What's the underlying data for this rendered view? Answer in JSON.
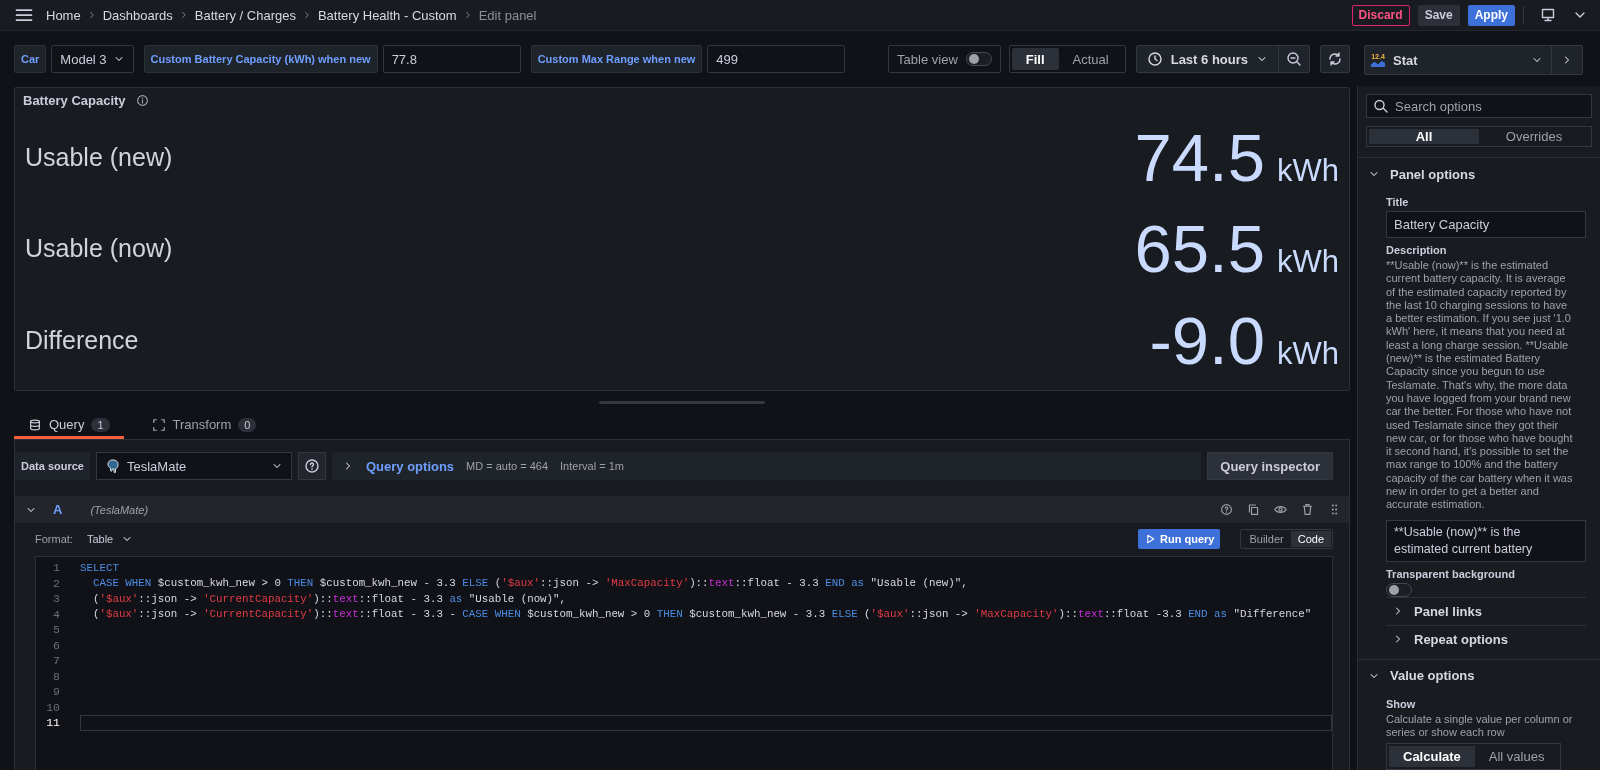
{
  "topbar": {
    "breadcrumbs": [
      {
        "label": "Home",
        "current": false
      },
      {
        "label": "Dashboards",
        "current": false
      },
      {
        "label": "Battery / Charges",
        "current": false
      },
      {
        "label": "Battery Health - Custom",
        "current": false
      },
      {
        "label": "Edit panel",
        "current": true
      }
    ],
    "buttons": [
      {
        "label": "Discard",
        "kind": "destructive"
      },
      {
        "label": "Save",
        "kind": "secondary"
      },
      {
        "label": "Apply",
        "kind": "primary"
      }
    ]
  },
  "variables": [
    {
      "label": "Car",
      "kind": "select",
      "value": "Model 3"
    },
    {
      "label": "Custom Battery Capacity (kWh) when new",
      "kind": "text",
      "value": "77.8"
    },
    {
      "label": "Custom Max Range when new",
      "kind": "text",
      "value": "499"
    }
  ],
  "toolbar": {
    "table_view": {
      "label": "Table view",
      "on": false
    },
    "fill_modes": [
      {
        "label": "Fill",
        "selected": true
      },
      {
        "label": "Actual",
        "selected": false
      }
    ],
    "time_range": "Last 6 hours"
  },
  "visualization": {
    "badge": "12.4",
    "name": "Stat"
  },
  "panel": {
    "title": "Battery Capacity",
    "stats": [
      {
        "label": "Usable (new)",
        "value": "74.5",
        "unit": "kWh"
      },
      {
        "label": "Usable (now)",
        "value": "65.5",
        "unit": "kWh"
      },
      {
        "label": "Difference",
        "value": "-9.0",
        "unit": "kWh"
      }
    ]
  },
  "query_tabs": [
    {
      "label": "Query",
      "count": "1",
      "selected": true
    },
    {
      "label": "Transform",
      "count": "0",
      "selected": false
    }
  ],
  "data_source": {
    "label": "Data source",
    "value": "TeslaMate",
    "query_options": "Query options",
    "md": "MD = auto = 464",
    "interval": "Interval = 1m",
    "inspector": "Query inspector"
  },
  "query": {
    "ref": "A",
    "source": "(TeslaMate)",
    "format_label": "Format:",
    "format": "Table",
    "run": "Run query",
    "modes": [
      {
        "label": "Builder",
        "selected": false
      },
      {
        "label": "Code",
        "selected": true
      }
    ],
    "lines": [
      {
        "number": "1",
        "active": false,
        "tokens": [
          {
            "kind": "keyword",
            "text": "SELECT"
          }
        ]
      },
      {
        "number": "2",
        "active": false,
        "tokens": [
          {
            "kind": "keyword",
            "text": "  CASE WHEN"
          },
          {
            "kind": "plain",
            "text": " $custom_kwh_new > 0 "
          },
          {
            "kind": "keyword",
            "text": "THEN"
          },
          {
            "kind": "plain",
            "text": " $custom_kwh_new - 3.3 "
          },
          {
            "kind": "keyword",
            "text": "ELSE"
          },
          {
            "kind": "plain",
            "text": " ("
          },
          {
            "kind": "string",
            "text": "'$aux'"
          },
          {
            "kind": "plain",
            "text": "::json -> "
          },
          {
            "kind": "string",
            "text": "'MaxCapacity'"
          },
          {
            "kind": "plain",
            "text": ")::"
          },
          {
            "kind": "type",
            "text": "text"
          },
          {
            "kind": "plain",
            "text": "::float - 3.3 "
          },
          {
            "kind": "keyword",
            "text": "END as"
          },
          {
            "kind": "plain",
            "text": " \"Usable (new)\","
          }
        ]
      },
      {
        "number": "3",
        "active": false,
        "tokens": [
          {
            "kind": "plain",
            "text": "  ("
          },
          {
            "kind": "string",
            "text": "'$aux'"
          },
          {
            "kind": "plain",
            "text": "::json -> "
          },
          {
            "kind": "string",
            "text": "'CurrentCapacity'"
          },
          {
            "kind": "plain",
            "text": ")::"
          },
          {
            "kind": "type",
            "text": "text"
          },
          {
            "kind": "plain",
            "text": "::float - 3.3 "
          },
          {
            "kind": "keyword",
            "text": "as"
          },
          {
            "kind": "plain",
            "text": " \"Usable (now)\","
          }
        ]
      },
      {
        "number": "4",
        "active": false,
        "tokens": [
          {
            "kind": "plain",
            "text": "  ("
          },
          {
            "kind": "string",
            "text": "'$aux'"
          },
          {
            "kind": "plain",
            "text": "::json -> "
          },
          {
            "kind": "string",
            "text": "'CurrentCapacity'"
          },
          {
            "kind": "plain",
            "text": ")::"
          },
          {
            "kind": "type",
            "text": "text"
          },
          {
            "kind": "plain",
            "text": "::float - 3.3 - "
          },
          {
            "kind": "keyword",
            "text": "CASE WHEN"
          },
          {
            "kind": "plain",
            "text": " $custom_kwh_new > 0 "
          },
          {
            "kind": "keyword",
            "text": "THEN"
          },
          {
            "kind": "plain",
            "text": " $custom_kwh_new - 3.3 "
          },
          {
            "kind": "keyword",
            "text": "ELSE"
          },
          {
            "kind": "plain",
            "text": " ("
          },
          {
            "kind": "string",
            "text": "'$aux'"
          },
          {
            "kind": "plain",
            "text": "::json -> "
          },
          {
            "kind": "string",
            "text": "'MaxCapacity'"
          },
          {
            "kind": "plain",
            "text": ")::"
          },
          {
            "kind": "type",
            "text": "text"
          },
          {
            "kind": "plain",
            "text": "::float -3.3 "
          },
          {
            "kind": "keyword",
            "text": "END as"
          },
          {
            "kind": "plain",
            "text": " \"Difference\""
          }
        ]
      },
      {
        "number": "5",
        "active": false
      },
      {
        "number": "6",
        "active": false
      },
      {
        "number": "7",
        "active": false
      },
      {
        "number": "8",
        "active": false
      },
      {
        "number": "9",
        "active": false
      },
      {
        "number": "10",
        "active": false
      },
      {
        "number": "11",
        "active": true
      }
    ]
  },
  "options": {
    "search_placeholder": "Search options",
    "tabs": [
      {
        "label": "All",
        "selected": true
      },
      {
        "label": "Overrides",
        "selected": false
      }
    ],
    "panel_options": {
      "title": "Panel options",
      "expanded": true,
      "title_label": "Title",
      "title_value": "Battery Capacity",
      "description_label": "Description",
      "description": "**Usable (now)** is the estimated current battery capacity. It is average of the estimated capacity reported by the last 10 charging sessions to have a better estimation. If you see just '1.0 kWh' here, it means that you need at least a long charge session. **Usable (new)** is the estimated Battery Capacity since you begun to use Teslamate. That's why, the more data you have logged from your brand new car the better. For those who have not used Teslamate since they got their new car, or for those who have bought it second hand, it's possible to set the max range to 100% and the battery capacity of the car battery when it was new in order to get a better and accurate estimation.",
      "description_value": "**Usable (now)** is the estimated current battery",
      "transparent_label": "Transparent background",
      "transparent": false,
      "subsections": [
        {
          "title": "Panel links",
          "expanded": false
        },
        {
          "title": "Repeat options",
          "expanded": false
        }
      ]
    },
    "value_options": {
      "title": "Value options",
      "expanded": true,
      "show_label": "Show",
      "show_help": "Calculate a single value per column or series or show each row",
      "show_modes": [
        {
          "label": "Calculate",
          "selected": true
        },
        {
          "label": "All values",
          "selected": false
        }
      ]
    }
  }
}
